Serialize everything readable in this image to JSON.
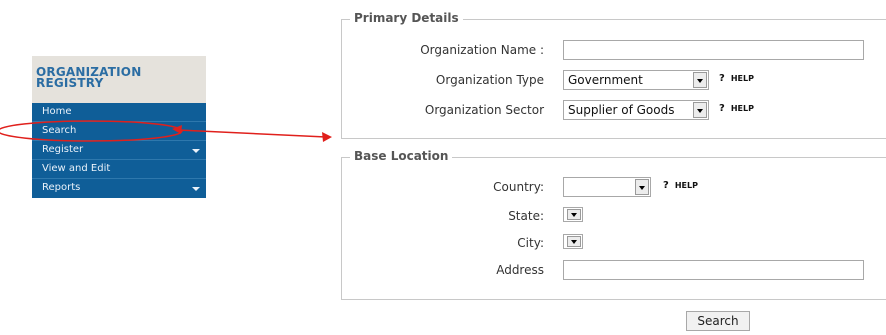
{
  "sidebar": {
    "title_line1": "ORGANIZATION",
    "title_line2": "REGISTRY",
    "items": [
      {
        "label": "Home"
      },
      {
        "label": "Search"
      },
      {
        "label": "Register"
      },
      {
        "label": "View and Edit"
      },
      {
        "label": "Reports"
      }
    ]
  },
  "primary": {
    "legend": "Primary Details",
    "org_name_label": "Organization Name :",
    "org_name_value": "",
    "org_type_label": "Organization Type",
    "org_type_value": "Government",
    "org_sector_label": "Organization Sector",
    "org_sector_value": "Supplier of Goods"
  },
  "location": {
    "legend": "Base Location",
    "country_label": "Country:",
    "country_value": "",
    "state_label": "State:",
    "city_label": "City:",
    "address_label": "Address",
    "address_value": ""
  },
  "help": {
    "mark": "?",
    "text": "HELP"
  },
  "search_button": "Search",
  "colors": {
    "sidebar_bg": "#0f5e98",
    "sidebar_header_bg": "#e5e2dc",
    "title_color": "#2b6da3",
    "annotation": "#e0201c"
  }
}
